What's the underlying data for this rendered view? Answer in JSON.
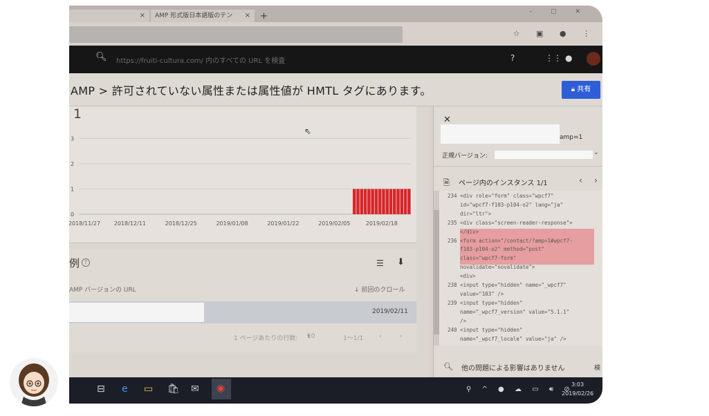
{
  "browser": {
    "tabs": [
      {
        "label": "",
        "close": "×"
      },
      {
        "label": "AMP 形式版日本語版のテン",
        "close": "×"
      }
    ],
    "new_tab": "+"
  },
  "app_header": {
    "search_placeholder": "https://fruiti-cultura.com/ 内のすべての URL を検査"
  },
  "title": {
    "text": "AMP  >  許可されていない属性または属性値が HMTL タグにあります。",
    "share_label": "共有"
  },
  "chart": {
    "count_label": "1"
  },
  "chart_data": {
    "type": "bar",
    "title": "",
    "xlabel": "",
    "ylabel": "",
    "x_ticks": [
      "2018/11/27",
      "2018/12/11",
      "2018/12/25",
      "2019/01/08",
      "2019/01/22",
      "2019/02/05",
      "2019/02/18"
    ],
    "y_ticks": [
      0,
      1,
      2,
      3
    ],
    "ylim": [
      0,
      3.5
    ],
    "series": [
      {
        "name": "",
        "color": "#d8262b",
        "points": [
          {
            "x": "2019/02/11",
            "y": 1
          },
          {
            "x": "2019/02/12",
            "y": 1
          },
          {
            "x": "2019/02/13",
            "y": 1
          },
          {
            "x": "2019/02/14",
            "y": 1
          },
          {
            "x": "2019/02/15",
            "y": 1
          },
          {
            "x": "2019/02/16",
            "y": 1
          },
          {
            "x": "2019/02/17",
            "y": 1
          },
          {
            "x": "2019/02/18",
            "y": 1
          },
          {
            "x": "2019/02/19",
            "y": 1
          },
          {
            "x": "2019/02/20",
            "y": 1
          },
          {
            "x": "2019/02/21",
            "y": 1
          },
          {
            "x": "2019/02/22",
            "y": 1
          },
          {
            "x": "2019/02/23",
            "y": 1
          },
          {
            "x": "2019/02/24",
            "y": 1
          },
          {
            "x": "2019/02/25",
            "y": 1
          },
          {
            "x": "2019/02/26",
            "y": 1
          }
        ]
      }
    ],
    "grid": true
  },
  "list": {
    "title": "例",
    "col_url": "AMP バージョンの URL",
    "col_crawl": "↓ 前回のクロール",
    "rows": [
      {
        "date": "2019/02/11"
      }
    ],
    "pager": {
      "rows_per_page_label": "1 ページあたりの行数:",
      "rows_per_page_value": "10",
      "range": "1〜1/1"
    }
  },
  "right_panel": {
    "amp_suffix": "amp=1",
    "canonical_label": "正規バージョン:",
    "instances_title": "ページ内のインスタンス 1/1",
    "code_lines": [
      "234 <div role=\"form\" class=\"wpcf7\"",
      "    id=\"wpcf7-f103-p104-o2\" lang=\"ja\"",
      "    dir=\"ltr\">",
      "235 <div class=\"screen-reader-response\">",
      "    </div>",
      "236 <form action=\"/contact/?amp=1#wpcf7-",
      "    f103-p104-o2\" method=\"post\"",
      "    class=\"wpcf7-form\"",
      "    novalidate=\"novalidate\">",
      "    <div>",
      "238 <input type=\"hidden\" name=\"_wpcf7\"",
      "    value=\"103\" />",
      "239 <input type=\"hidden\"",
      "    name=\"_wpcf7_version\" value=\"5.1.1\"",
      "    />",
      "240 <input type=\"hidden\"",
      "    name=\"_wpcf7_locale\" value=\"ja\" />"
    ],
    "footer_text": "他の問題による影響はありません",
    "footer_cut": "検"
  },
  "taskbar": {
    "time": "3:03",
    "date": "2019/02/26"
  }
}
